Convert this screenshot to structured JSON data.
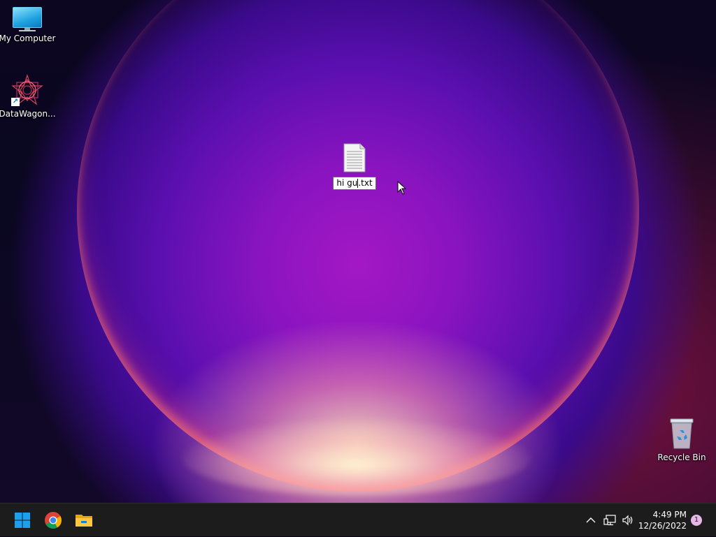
{
  "desktop": {
    "icons": {
      "my_computer": {
        "label": "My Computer",
        "icon": "monitor-icon"
      },
      "datawagon": {
        "label": "DataWagon...",
        "icon": "datawagon-shortcut-icon"
      },
      "text_file": {
        "label": "hi gu.txt",
        "value_before_caret": "hi gu",
        "value_after_caret": ".txt",
        "icon": "text-file-icon"
      },
      "recycle_bin": {
        "label": "Recycle Bin",
        "icon": "recycle-bin-icon"
      }
    }
  },
  "taskbar": {
    "pinned": [
      {
        "name": "start",
        "icon": "windows-start-icon"
      },
      {
        "name": "chrome",
        "icon": "chrome-icon"
      },
      {
        "name": "file-explorer",
        "icon": "folder-icon"
      }
    ],
    "tray": {
      "overflow_icon": "chevron-up-icon",
      "network_icon": "network-icon",
      "volume_icon": "volume-icon",
      "time": "4:49 PM",
      "date": "12/26/2022",
      "notification_count": "1"
    }
  },
  "colors": {
    "taskbar": "#1c1c1c",
    "windows_blue": "#1aa0f0"
  }
}
